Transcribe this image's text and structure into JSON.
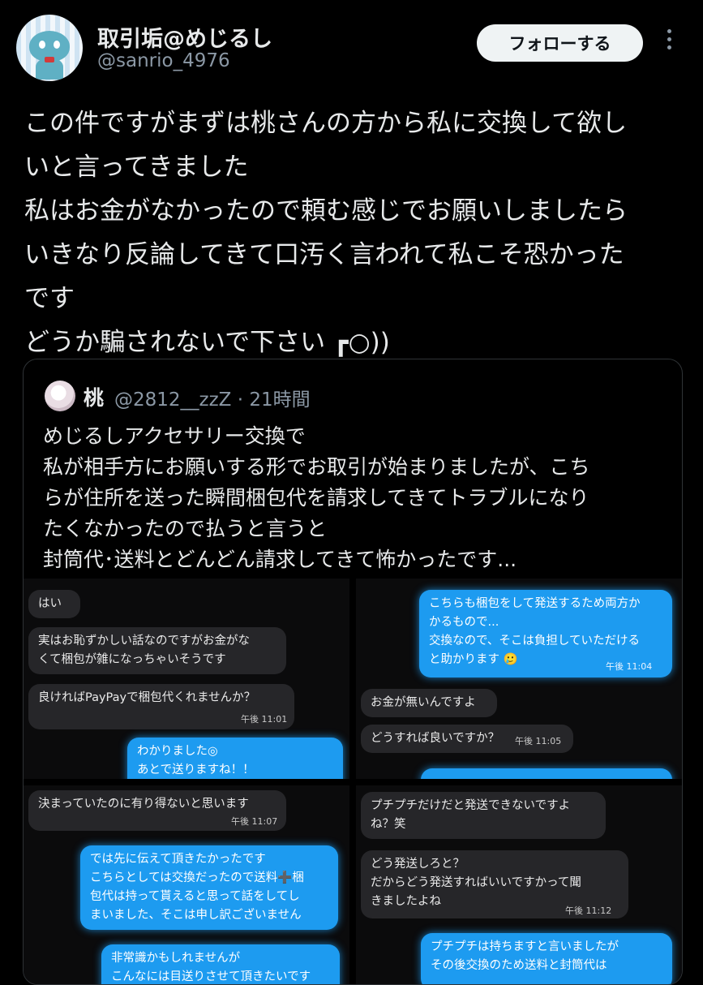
{
  "author": {
    "display_name": "取引垢@めじるし",
    "handle": "@sanrio_4976",
    "follow_label": "フォローする"
  },
  "tweet": {
    "lines": [
      "この件ですがまずは桃さんの方から私に交換して欲し",
      "いと言ってきました",
      "私はお金がなかったので頼む感じでお願いしましたら",
      "いきなり反論してきて口汚く言われて私こそ恐かった",
      "です",
      "どうか騙されないで下さい ┏○))"
    ]
  },
  "quote": {
    "name": "桃",
    "meta": "@2812__zzZ · 21時間",
    "lines": [
      "めじるしアクセサリー交換で",
      "私が相手方にお願いする形でお取引が始まりましたが、こち",
      "らが住所を送った瞬間梱包代を請求してきてトラブルになり",
      "たくなかったので払うと言うと",
      "封筒代･送料とどんどん請求してきて怖かったです..."
    ]
  },
  "screenshots": {
    "s1": {
      "b1": [
        "はい"
      ],
      "b2": [
        "実はお恥ずかしい話なのですがお金がな",
        "くて梱包が雑になっちゃいそうです"
      ],
      "b3": [
        "良ければPayPayで梱包代くれませんか？"
      ],
      "t3": "午後 11:01",
      "b4": [
        "わかりました◎",
        "あとで送りますね！！"
      ]
    },
    "s2": {
      "b1": [
        "こちらも梱包をして発送するため両方か",
        "かるもので...",
        "交換なので、そこは負担していただける",
        "と助かります 🥲"
      ],
      "t1": "午後 11:04",
      "b2": [
        "お金が無いんですよ"
      ],
      "b3": [
        "どうすれば良いですか？"
      ],
      "t3": "午後 11:05"
    },
    "s3": {
      "b1": [
        "決まっていたのに有り得ないと思います"
      ],
      "t1": "午後 11:07",
      "b2": [
        "では先に伝えて頂きたかったです",
        "こちらとしては交換だったので送料➕梱",
        "包代は持って貰えると思って話をしてし",
        "まいました、そこは申し訳ございません"
      ],
      "b3": [
        "非常識かもしれませんが",
        "こんなには目送りさせて頂きたいです"
      ]
    },
    "s4": {
      "b1": [
        "プチプチだけだと発送できないですよ",
        "ね？笑"
      ],
      "b2": [
        "どう発送しろと？",
        "だからどう発送すればいいですかって聞",
        "きましたよね"
      ],
      "t2": "午後 11:12",
      "b3": [
        "プチプチは持ちますと言いましたが",
        "その後交換のため送料と封筒代は"
      ]
    }
  }
}
